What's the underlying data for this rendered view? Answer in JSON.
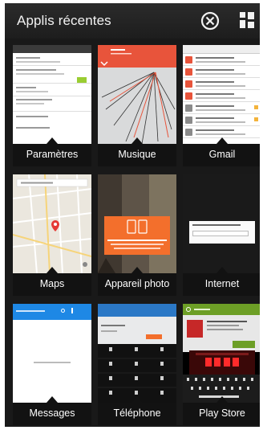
{
  "header": {
    "title": "Applis récentes"
  },
  "apps": [
    {
      "label": "Paramètres"
    },
    {
      "label": "Musique"
    },
    {
      "label": "Gmail"
    },
    {
      "label": "Maps"
    },
    {
      "label": "Appareil photo"
    },
    {
      "label": "Internet"
    },
    {
      "label": "Messages"
    },
    {
      "label": "Téléphone"
    },
    {
      "label": "Play Store"
    }
  ],
  "colors": {
    "header_bg": "#262626",
    "screen_bg": "#191919",
    "label_bar": "#121212",
    "music_accent": "#e8543b",
    "camera_accent": "#f36f2c",
    "messages_accent": "#1e88e5",
    "phone_accent": "#2b78c6",
    "playstore_accent": "#6d9f26"
  },
  "icons": [
    "close-all-icon",
    "grid-view-icon"
  ]
}
